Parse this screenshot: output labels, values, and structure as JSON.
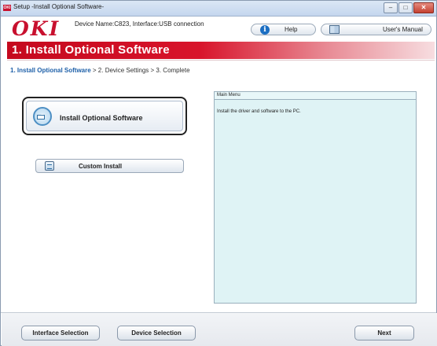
{
  "window": {
    "title": "Setup -Install Optional Software-",
    "app_icon_text": "OKI",
    "controls": {
      "minimize": "–",
      "maximize": "□",
      "close": "✕"
    }
  },
  "header": {
    "logo": "OKI",
    "device_info": "Device Name:C823, Interface:USB connection",
    "help_label": "Help",
    "manual_label": "User's Manual",
    "help_icon": "info-icon",
    "manual_icon": "book-icon"
  },
  "banner": {
    "title": "1. Install Optional Software"
  },
  "breadcrumb": {
    "active": "1. Install Optional Software",
    "rest": " > 2. Device Settings > 3. Complete"
  },
  "main": {
    "primary_button": {
      "label": "Install Optional Software",
      "icon": "disc-install-icon"
    },
    "custom_button": {
      "label": "Custom Install",
      "icon": "custom-install-icon"
    }
  },
  "info_panel": {
    "header": "Main Menu",
    "body": "Install the driver and software to the PC."
  },
  "footer": {
    "interface_button": "Interface Selection",
    "device_button": "Device Selection",
    "next_button": "Next"
  },
  "colors": {
    "brand_red": "#c8102e",
    "breadcrumb_active": "#1d5fa8",
    "panel_background": "#dff3f5"
  }
}
